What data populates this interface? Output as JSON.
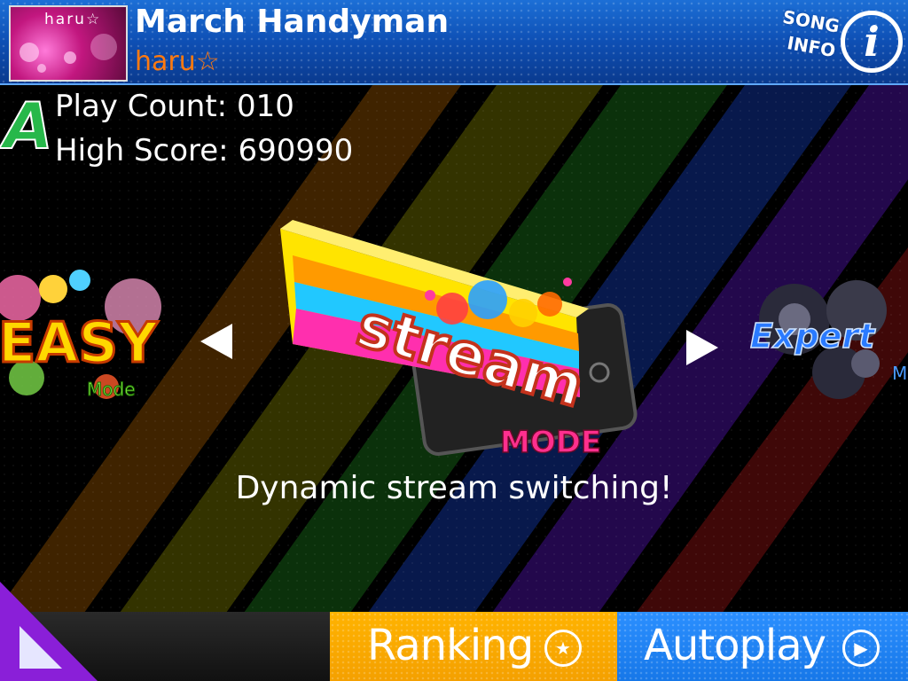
{
  "header": {
    "jacket_text": "haru☆",
    "song_title": "March Handyman",
    "artist": "haru☆",
    "song_info_line1": "SONG",
    "song_info_line2": "INFO",
    "info_glyph": "i"
  },
  "stats": {
    "grade": "A",
    "play_count": "Play Count: 010",
    "high_score": "High Score: 690990"
  },
  "modes": {
    "left": {
      "title": "EASY",
      "subtitle": "Mode"
    },
    "center": {
      "title": "stream",
      "subtitle": "MODE"
    },
    "right": {
      "title": "Expert",
      "subtitle": "M"
    }
  },
  "description": "Dynamic stream switching!",
  "bottom": {
    "ranking_label": "Ranking",
    "ranking_icon": "★",
    "autoplay_label": "Autoplay",
    "autoplay_icon": "▶"
  },
  "colors": {
    "header_blue": "#0e4fb4",
    "artist_orange": "#ff7a10",
    "grade_green": "#27b84a",
    "ranking_orange": "#f4a000",
    "autoplay_blue": "#1677e8"
  },
  "icons": [
    "info-icon",
    "left-arrow-icon",
    "right-arrow-icon",
    "back-triangle-icon",
    "star-icon",
    "play-icon"
  ]
}
